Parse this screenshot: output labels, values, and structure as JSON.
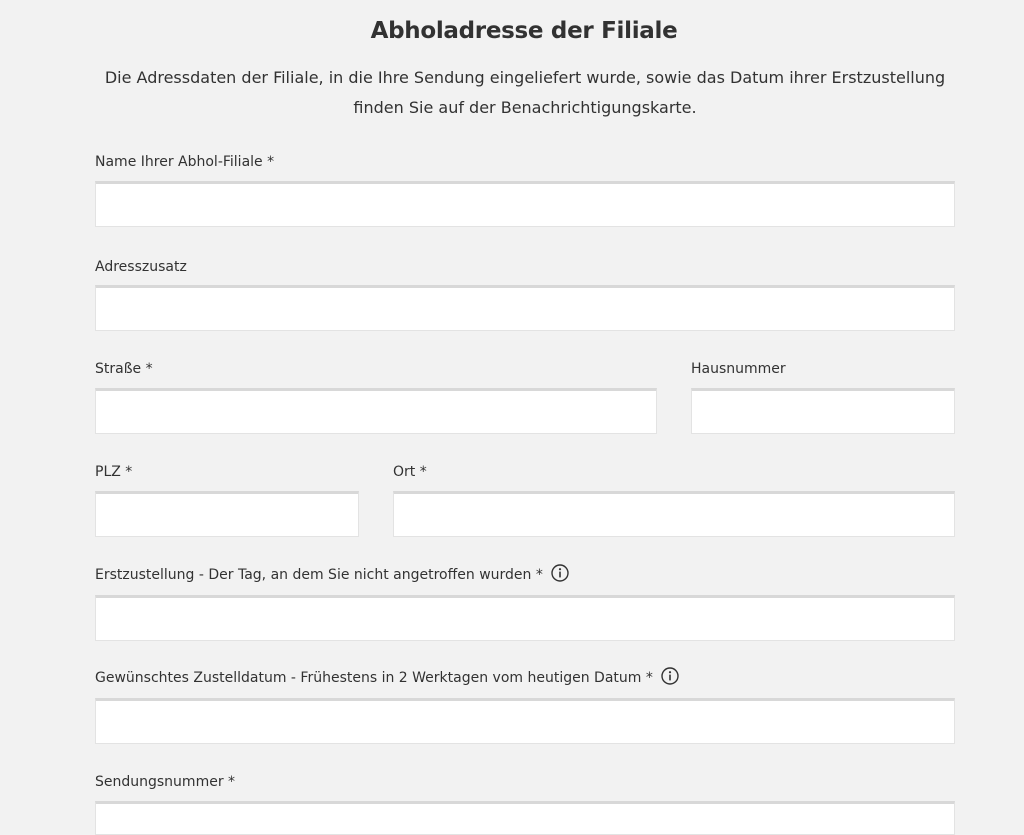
{
  "header": {
    "title": "Abholadresse der Filiale",
    "intro_line1": "Die Adressdaten der Filiale, in die Ihre Sendung eingeliefert wurde, sowie das Datum ihrer Erstzustellung",
    "intro_line2": "finden Sie auf der Benachrichtigungskarte."
  },
  "form": {
    "filiale_name": {
      "label": "Name Ihrer Abhol-Filiale *",
      "value": ""
    },
    "adresszusatz": {
      "label": "Adresszusatz",
      "value": ""
    },
    "strasse": {
      "label": "Straße *",
      "value": ""
    },
    "hausnummer": {
      "label": "Hausnummer",
      "value": ""
    },
    "plz": {
      "label": "PLZ *",
      "value": ""
    },
    "ort": {
      "label": "Ort *",
      "value": ""
    },
    "erstzustellung": {
      "label": "Erstzustellung - Der Tag, an dem Sie nicht angetroffen wurden *",
      "value": "",
      "icon": "info-icon"
    },
    "zustelldatum": {
      "label": "Gewünschtes Zustelldatum - Frühestens in 2 Werktagen vom heutigen Datum *",
      "value": "",
      "icon": "info-icon"
    },
    "sendungsnummer": {
      "label": "Sendungsnummer *",
      "value": ""
    }
  },
  "colors": {
    "background": "#f2f2f2",
    "text": "#323232",
    "input_background": "#ffffff",
    "input_border": "#d8d8d8"
  }
}
